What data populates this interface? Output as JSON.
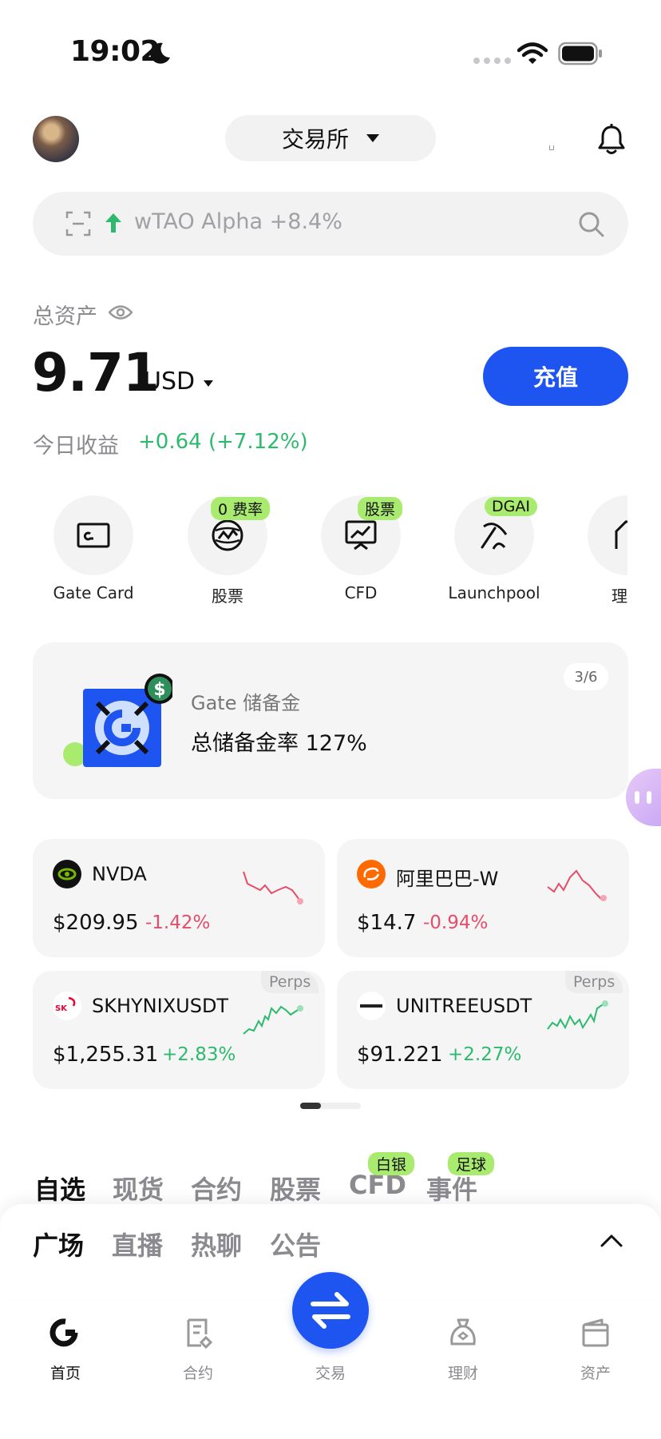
{
  "status_bar": {
    "time": "19:02"
  },
  "header": {
    "exchange_label": "交易所"
  },
  "search": {
    "trending_text": "wTAO Alpha +8.4%"
  },
  "assets": {
    "label": "总资产",
    "value": "9.71",
    "currency": "USD",
    "deposit_label": "充值",
    "profit_label": "今日收益",
    "profit_value": "+0.64 (+7.12%)"
  },
  "shortcuts": [
    {
      "label": "Gate Card",
      "badge": ""
    },
    {
      "label": "股票",
      "badge": "0 费率"
    },
    {
      "label": "CFD",
      "badge": "股票"
    },
    {
      "label": "Launchpool",
      "badge": "DGAI"
    },
    {
      "label": "理",
      "badge": ""
    }
  ],
  "reserve": {
    "title": "Gate 储备金",
    "rate_text": "总储备金率 127%",
    "page": "3/6"
  },
  "markets": [
    {
      "name": "NVDA",
      "price": "$209.95",
      "change": "-1.42%",
      "direction": "down",
      "tag": ""
    },
    {
      "name": "阿里巴巴-W",
      "price": "$14.7",
      "change": "-0.94%",
      "direction": "down",
      "tag": ""
    },
    {
      "name": "SKHYNIXUSDT",
      "price": "$1,255.31",
      "change": "+2.83%",
      "direction": "up",
      "tag": "Perps"
    },
    {
      "name": "UNITREEUSDT",
      "price": "$91.221",
      "change": "+2.27%",
      "direction": "up",
      "tag": "Perps"
    }
  ],
  "tabs_primary": [
    {
      "label": "自选",
      "badge": ""
    },
    {
      "label": "现货",
      "badge": ""
    },
    {
      "label": "合约",
      "badge": ""
    },
    {
      "label": "股票",
      "badge": ""
    },
    {
      "label": "CFD",
      "badge": "白银"
    },
    {
      "label": "事件",
      "badge": "足球"
    }
  ],
  "tabs_secondary": [
    "广场",
    "直播",
    "热聊",
    "公告"
  ],
  "bottom_nav": [
    "首页",
    "合约",
    "交易",
    "理财",
    "资产"
  ],
  "colors": {
    "brand_blue": "#1e54f0",
    "up_green": "#2dba6e",
    "down_red": "#e54d6a",
    "badge_green": "#a9eb6f"
  }
}
